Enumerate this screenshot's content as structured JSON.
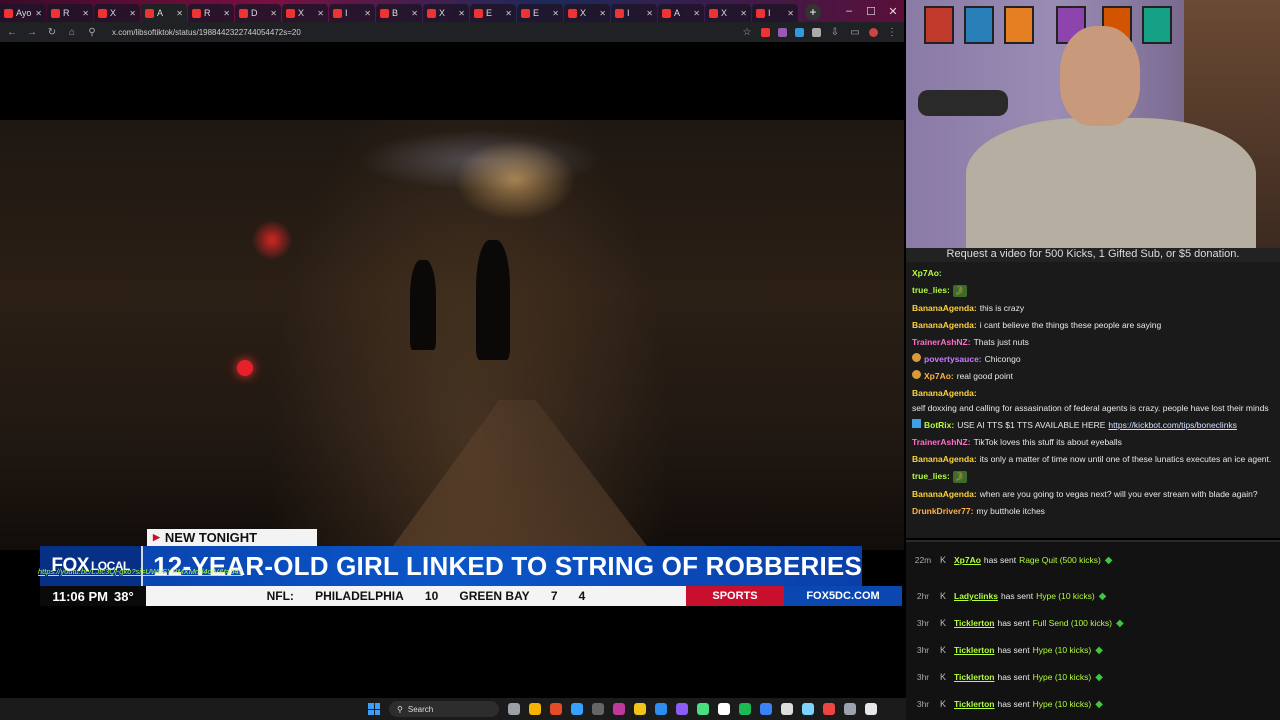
{
  "browser": {
    "tabs": [
      "Ayo",
      "R",
      "X",
      "A",
      "R",
      "D",
      "X",
      "I",
      "B",
      "X",
      "E",
      "E",
      "X",
      "I",
      "A",
      "X",
      "I"
    ],
    "url": "x.com/libsoftiktok/status/1988442322744054472s=20",
    "window_controls": [
      "–",
      "☐",
      "✕"
    ],
    "newtab": "+"
  },
  "lower_third": {
    "tag": "NEW TONIGHT",
    "logo": "FOX",
    "logo_sub": "LOCAL",
    "headline": "12-YEAR-OLD GIRL LINKED TO STRING OF ROBBERIES",
    "time": "11:06 PM",
    "temp": "38°",
    "league": "NFL:",
    "team1": "PHILADELPHIA",
    "score1": "10",
    "team2": "GREEN BAY",
    "score2": "7",
    "quarter": "4",
    "sports": "SPORTS",
    "site": "FOX5DC.COM"
  },
  "chat": {
    "banner": "Request a video for 500 Kicks, 1 Gifted Sub, or $5 donation.",
    "messages": [
      {
        "user": "Xp7Ao:",
        "text": "",
        "emote": "",
        "color": "#b4ff3a"
      },
      {
        "user": "true_lies:",
        "text": "",
        "emote": "🐊",
        "color": "#b4ff3a"
      },
      {
        "user": "BananaAgenda:",
        "text": "this is crazy",
        "color": "#ffd23a"
      },
      {
        "user": "BananaAgenda:",
        "text": "i cant believe the things these people are saying",
        "color": "#ffd23a"
      },
      {
        "user": "TrainerAshNZ:",
        "text": "Thats just nuts",
        "color": "#ff6ec7"
      },
      {
        "user": "povertysauce:",
        "text": "Chicongo",
        "color": "#c77dff",
        "badge": true
      },
      {
        "user": "Xp7Ao:",
        "text": "real good point",
        "color": "#ffb347",
        "badge": true
      },
      {
        "user": "BananaAgenda:",
        "text": "self doxxing and calling for assasination of federal agents is crazy. people have lost their minds",
        "color": "#ffd23a"
      },
      {
        "user": "BotRix:",
        "text": "USE AI TTS $1 TTS AVAILABLE HERE",
        "link": "https://kickbot.com/tips/boneclinks",
        "color": "#b4ff3a",
        "bot": true
      },
      {
        "user": "TrainerAshNZ:",
        "text": "TikTok loves this stuff its about eyeballs",
        "color": "#ff6ec7"
      },
      {
        "user": "BananaAgenda:",
        "text": "its only a matter of time now until one of these lunatics executes an ice agent.",
        "color": "#ffd23a"
      },
      {
        "user": "true_lies:",
        "text": "",
        "emote": "🐊",
        "color": "#b4ff3a"
      },
      {
        "user": "BananaAgenda:",
        "text": "when are you going to vegas next? will you ever stream with blade again?",
        "color": "#ffd23a"
      },
      {
        "user": "DrunkDriver77:",
        "text": "my butthole itches",
        "color": "#ffb347"
      }
    ]
  },
  "feed": {
    "link": "https://youtu.be/LJtc3Qj-gko?si=UWbSYRMXMnd4ofV&t=547",
    "rows": [
      {
        "time": "22m",
        "user": "Xp7Ao",
        "verb": "has sent",
        "item": "Rage Quit (500 kicks)"
      },
      {
        "time": "2hr",
        "user": "Ladyclinks",
        "verb": "has sent",
        "item": "Hype (10 kicks)"
      },
      {
        "time": "3hr",
        "user": "Ticklerton",
        "verb": "has sent",
        "item": "Full Send (100 kicks)"
      },
      {
        "time": "3hr",
        "user": "Ticklerton",
        "verb": "has sent",
        "item": "Hype (10 kicks)"
      },
      {
        "time": "3hr",
        "user": "Ticklerton",
        "verb": "has sent",
        "item": "Hype (10 kicks)"
      },
      {
        "time": "3hr",
        "user": "Ticklerton",
        "verb": "has sent",
        "item": "Hype (10 kicks)"
      }
    ]
  },
  "taskbar": {
    "search": "Search",
    "apps": [
      "#9aa0a6",
      "#f5b400",
      "#e34c26",
      "#3aa0ff",
      "#666",
      "#c0399a",
      "#f0c419",
      "#2d8cf0",
      "#8b5cf6",
      "#4ade80",
      "#fff",
      "#1db954",
      "#3b82f6",
      "#ddd",
      "#7dd3fc",
      "#ef4444",
      "#9ca3af",
      "#e5e7eb"
    ]
  }
}
